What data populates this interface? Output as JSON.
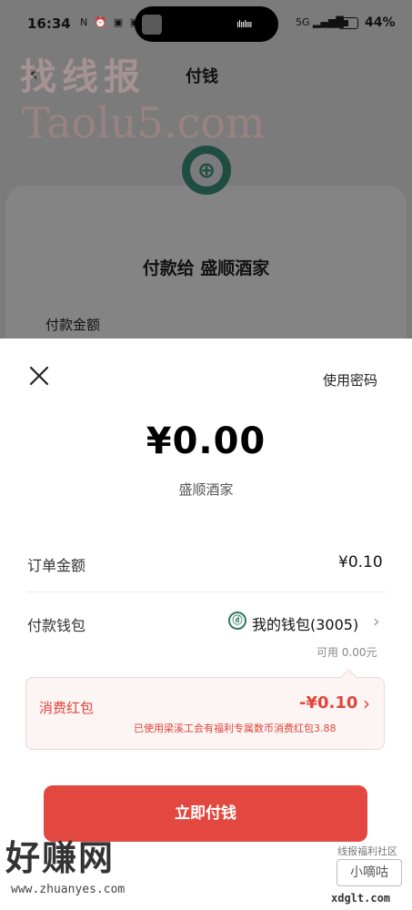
{
  "status_bar": {
    "time": "16:34",
    "notif_icons": "N ⏰ ▣ ▣",
    "island_wave": "ılıılııı",
    "signal_text": "5G ▂▄▆█",
    "battery": "44%"
  },
  "background_page": {
    "title": "付钱",
    "payee": "付款给 盛顺酒家",
    "amount_label": "付款金额",
    "logo_glyph": "⊕"
  },
  "watermarks": {
    "top_cn": "找线报",
    "top_en": "Taolu5.com",
    "bottom_cn": "好赚网",
    "bottom_en": "www.zhuanyes.com",
    "bottom_right_small": "线报福利社区",
    "bottom_right_box": "小嘀咕",
    "bottom_right_domain": "xdglt.com"
  },
  "sheet": {
    "use_password": "使用密码",
    "amount": "¥0.00",
    "merchant": "盛顺酒家",
    "order_label": "订单金额",
    "order_value": "¥0.10",
    "wallet_label": "付款钱包",
    "wallet_icon": "ⓓ",
    "wallet_value": "我的钱包(3005)",
    "available": "可用 0.00元",
    "red_packet": {
      "label": "消费红包",
      "amount": "-¥0.10",
      "note": "已使用梁溪工会有福利专属数币消费红包3.88"
    },
    "pay_button": "立即付钱"
  },
  "colors": {
    "accent_red": "#e2483f",
    "bank_green": "#1f4d40",
    "overlay_gray": "#7b7b7b"
  }
}
